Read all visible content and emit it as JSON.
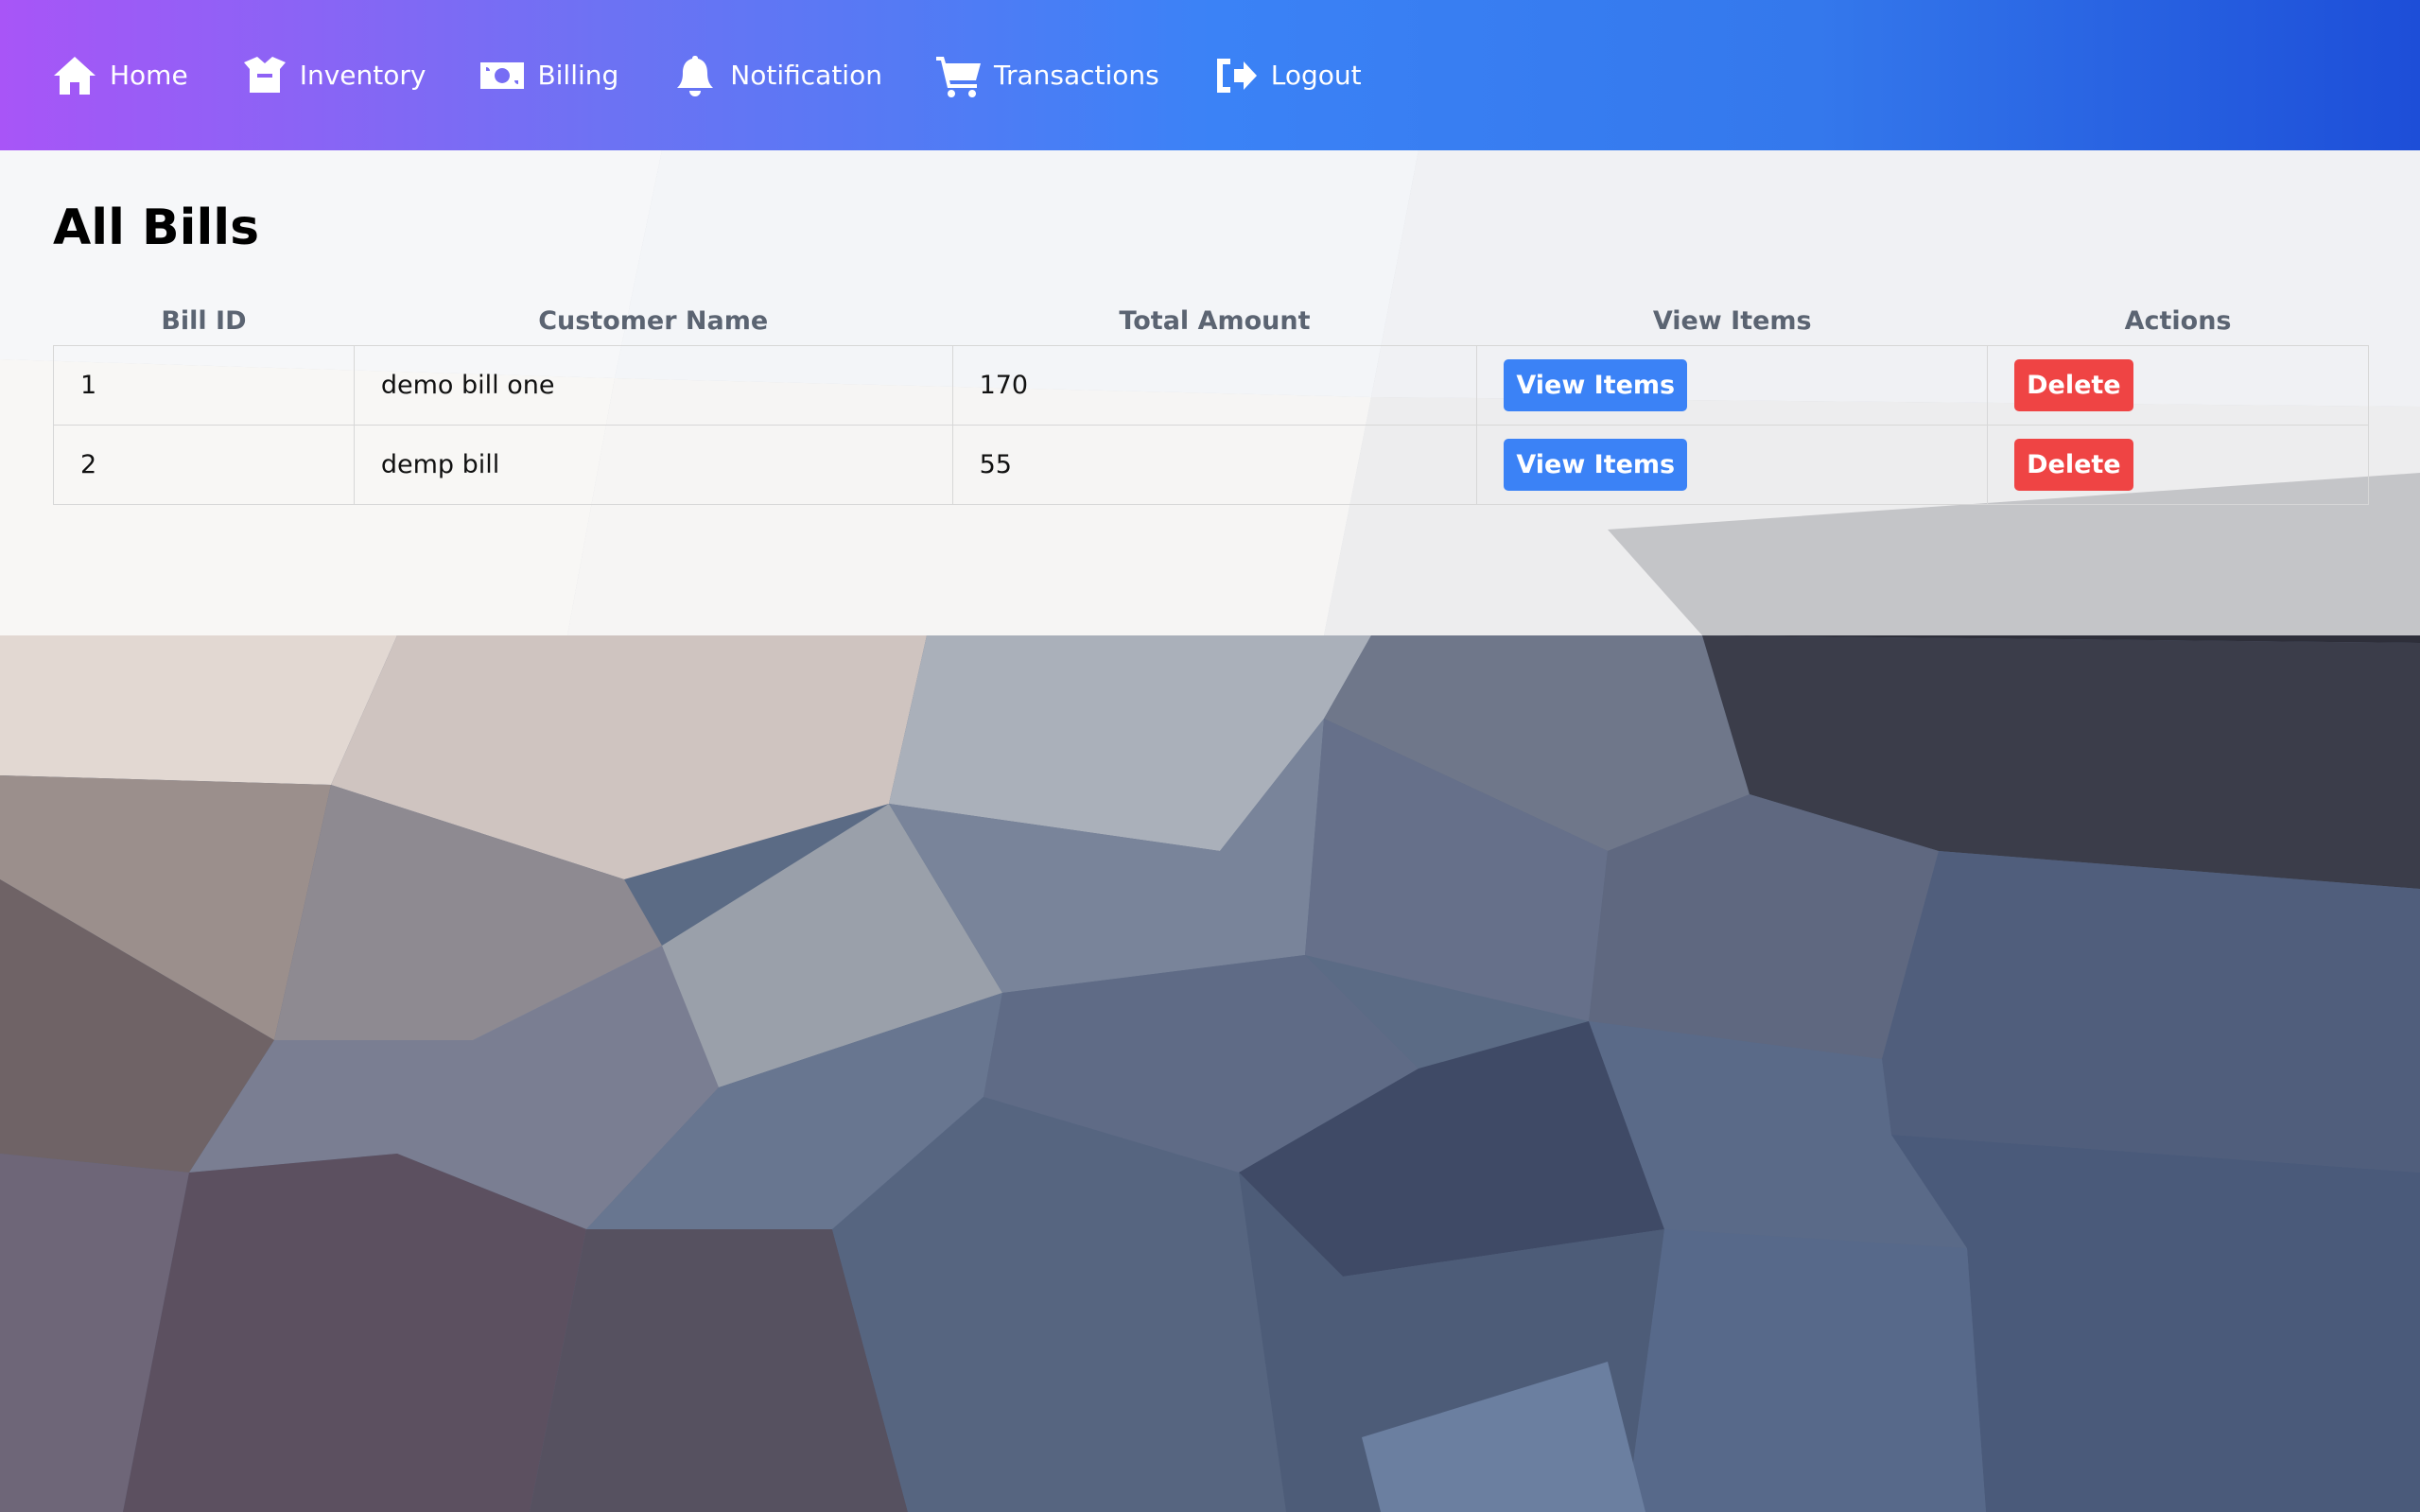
{
  "colors": {
    "nav_gradient": [
      "#a855f7",
      "#3b82f6",
      "#1d4ed8"
    ],
    "view_button": "#3b82f6",
    "delete_button": "#ef4444"
  },
  "nav": {
    "items": [
      {
        "label": "Home",
        "icon": "home-icon"
      },
      {
        "label": "Inventory",
        "icon": "box-icon"
      },
      {
        "label": "Billing",
        "icon": "money-bill-icon"
      },
      {
        "label": "Notification",
        "icon": "bell-icon"
      },
      {
        "label": "Transactions",
        "icon": "cart-icon"
      },
      {
        "label": "Logout",
        "icon": "logout-icon"
      }
    ]
  },
  "page": {
    "title": "All Bills"
  },
  "table": {
    "headers": [
      "Bill ID",
      "Customer Name",
      "Total Amount",
      "View Items",
      "Actions"
    ],
    "rows": [
      {
        "id": "1",
        "customer": "demo bill one",
        "total": "170",
        "view_label": "View Items",
        "action_label": "Delete"
      },
      {
        "id": "2",
        "customer": "demp bill",
        "total": "55",
        "view_label": "View Items",
        "action_label": "Delete"
      }
    ]
  }
}
